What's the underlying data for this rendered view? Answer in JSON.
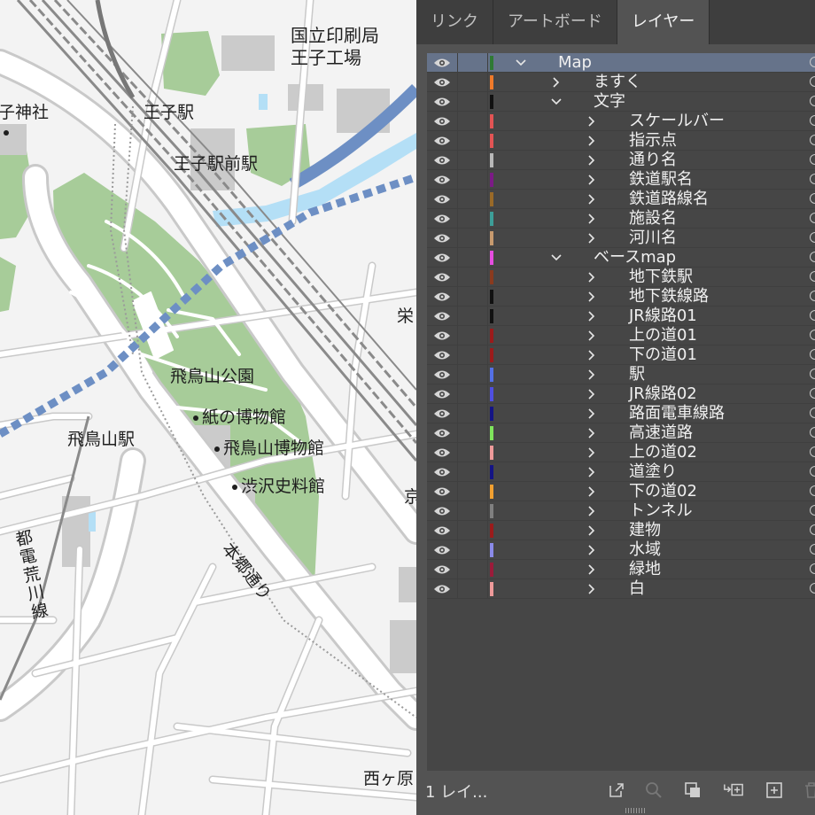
{
  "panel": {
    "tabs": [
      {
        "label": "リンク",
        "active": false
      },
      {
        "label": "アートボード",
        "active": false
      },
      {
        "label": "レイヤー",
        "active": true
      }
    ],
    "layers": [
      {
        "name": "Map",
        "depth": 0,
        "expanded": true,
        "color": "#2f7a34",
        "selected": true
      },
      {
        "name": "ますく",
        "depth": 1,
        "expanded": false,
        "color": "#f07a2a"
      },
      {
        "name": "文字",
        "depth": 1,
        "expanded": true,
        "color": "#111111"
      },
      {
        "name": "スケールバー",
        "depth": 2,
        "expanded": false,
        "color": "#e25454"
      },
      {
        "name": "指示点",
        "depth": 2,
        "expanded": false,
        "color": "#e25454"
      },
      {
        "name": "通り名",
        "depth": 2,
        "expanded": false,
        "color": "#b8b8b8"
      },
      {
        "name": "鉄道駅名",
        "depth": 2,
        "expanded": false,
        "color": "#7c1a86"
      },
      {
        "name": "鉄道路線名",
        "depth": 2,
        "expanded": false,
        "color": "#9a6a28"
      },
      {
        "name": "施設名",
        "depth": 2,
        "expanded": false,
        "color": "#3d9e98"
      },
      {
        "name": "河川名",
        "depth": 2,
        "expanded": false,
        "color": "#c79a6e"
      },
      {
        "name": "ベースmap",
        "depth": 1,
        "expanded": true,
        "color": "#e64de0"
      },
      {
        "name": "地下鉄駅",
        "depth": 2,
        "expanded": false,
        "color": "#8a3a1e"
      },
      {
        "name": "地下鉄線路",
        "depth": 2,
        "expanded": false,
        "color": "#111111"
      },
      {
        "name": "JR線路01",
        "depth": 2,
        "expanded": false,
        "color": "#111111"
      },
      {
        "name": "上の道01",
        "depth": 2,
        "expanded": false,
        "color": "#9b1b1b"
      },
      {
        "name": "下の道01",
        "depth": 2,
        "expanded": false,
        "color": "#9b1b1b"
      },
      {
        "name": "駅",
        "depth": 2,
        "expanded": false,
        "color": "#5470e6"
      },
      {
        "name": "JR線路02",
        "depth": 2,
        "expanded": false,
        "color": "#4f4fe0"
      },
      {
        "name": "路面電車線路",
        "depth": 2,
        "expanded": false,
        "color": "#141485"
      },
      {
        "name": "高速道路",
        "depth": 2,
        "expanded": false,
        "color": "#7fe45c"
      },
      {
        "name": "上の道02",
        "depth": 2,
        "expanded": false,
        "color": "#ee9a9a"
      },
      {
        "name": "道塗り",
        "depth": 2,
        "expanded": false,
        "color": "#141485"
      },
      {
        "name": "下の道02",
        "depth": 2,
        "expanded": false,
        "color": "#f2a030"
      },
      {
        "name": "トンネル",
        "depth": 2,
        "expanded": false,
        "color": "#808080"
      },
      {
        "name": "建物",
        "depth": 2,
        "expanded": false,
        "color": "#9b1b1b"
      },
      {
        "name": "水域",
        "depth": 2,
        "expanded": false,
        "color": "#8a8ae8"
      },
      {
        "name": "緑地",
        "depth": 2,
        "expanded": false,
        "color": "#9b1b3a"
      },
      {
        "name": "白",
        "depth": 2,
        "expanded": false,
        "color": "#ee9a9a"
      }
    ],
    "footer": {
      "count_label": "1 レイ...",
      "buttons": [
        {
          "name": "export-icon"
        },
        {
          "name": "locate-icon"
        },
        {
          "name": "clipping-mask-icon"
        },
        {
          "name": "new-sublayer-icon"
        },
        {
          "name": "new-layer-icon"
        },
        {
          "name": "delete-icon"
        }
      ]
    }
  },
  "map": {
    "labels": {
      "printing_bureau": "国立印刷局\n王子工場",
      "oji_shrine": "子神社",
      "oji_station": "王子駅",
      "oji_ekimae": "王子駅前駅",
      "asukayama_park": "飛鳥山公園",
      "paper_museum": "紙の博物館",
      "asukayama_museum": "飛鳥山博物館",
      "shibusawa": "渋沢史料館",
      "asukayama_station": "飛鳥山駅",
      "hongo_dori": "本郷通り",
      "toden_arakawa": "都電荒川線",
      "sakae": "栄",
      "kyo_fragment": "京",
      "nishigahara": "西ヶ原"
    },
    "colors": {
      "background": "#f3f3f3",
      "road": "#ffffff",
      "road_edge": "#c9c9c9",
      "park": "#a7cc99",
      "water": "#b4dff6",
      "river": "#6d8fc4",
      "building": "#cbcbcb",
      "rail": "#8a8a8a",
      "subway": "#6d8fc4"
    }
  }
}
